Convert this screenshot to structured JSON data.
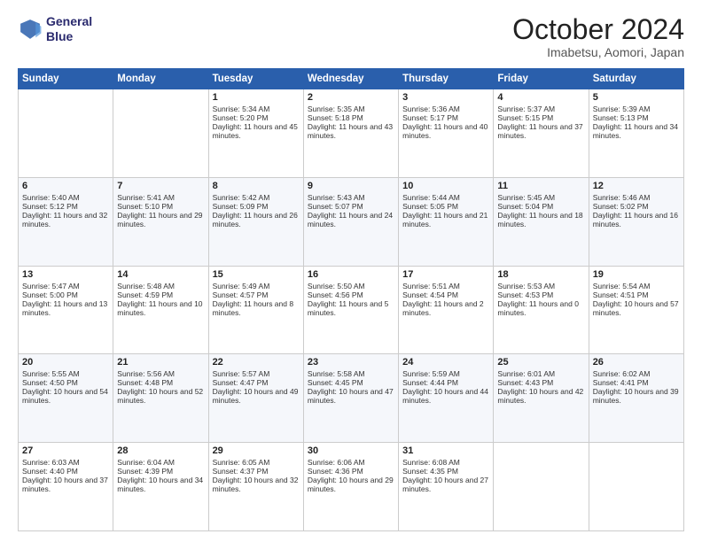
{
  "header": {
    "logo_line1": "General",
    "logo_line2": "Blue",
    "title": "October 2024",
    "location": "Imabetsu, Aomori, Japan"
  },
  "weekdays": [
    "Sunday",
    "Monday",
    "Tuesday",
    "Wednesday",
    "Thursday",
    "Friday",
    "Saturday"
  ],
  "weeks": [
    [
      {
        "day": "",
        "sunrise": "",
        "sunset": "",
        "daylight": ""
      },
      {
        "day": "",
        "sunrise": "",
        "sunset": "",
        "daylight": ""
      },
      {
        "day": "1",
        "sunrise": "Sunrise: 5:34 AM",
        "sunset": "Sunset: 5:20 PM",
        "daylight": "Daylight: 11 hours and 45 minutes."
      },
      {
        "day": "2",
        "sunrise": "Sunrise: 5:35 AM",
        "sunset": "Sunset: 5:18 PM",
        "daylight": "Daylight: 11 hours and 43 minutes."
      },
      {
        "day": "3",
        "sunrise": "Sunrise: 5:36 AM",
        "sunset": "Sunset: 5:17 PM",
        "daylight": "Daylight: 11 hours and 40 minutes."
      },
      {
        "day": "4",
        "sunrise": "Sunrise: 5:37 AM",
        "sunset": "Sunset: 5:15 PM",
        "daylight": "Daylight: 11 hours and 37 minutes."
      },
      {
        "day": "5",
        "sunrise": "Sunrise: 5:39 AM",
        "sunset": "Sunset: 5:13 PM",
        "daylight": "Daylight: 11 hours and 34 minutes."
      }
    ],
    [
      {
        "day": "6",
        "sunrise": "Sunrise: 5:40 AM",
        "sunset": "Sunset: 5:12 PM",
        "daylight": "Daylight: 11 hours and 32 minutes."
      },
      {
        "day": "7",
        "sunrise": "Sunrise: 5:41 AM",
        "sunset": "Sunset: 5:10 PM",
        "daylight": "Daylight: 11 hours and 29 minutes."
      },
      {
        "day": "8",
        "sunrise": "Sunrise: 5:42 AM",
        "sunset": "Sunset: 5:09 PM",
        "daylight": "Daylight: 11 hours and 26 minutes."
      },
      {
        "day": "9",
        "sunrise": "Sunrise: 5:43 AM",
        "sunset": "Sunset: 5:07 PM",
        "daylight": "Daylight: 11 hours and 24 minutes."
      },
      {
        "day": "10",
        "sunrise": "Sunrise: 5:44 AM",
        "sunset": "Sunset: 5:05 PM",
        "daylight": "Daylight: 11 hours and 21 minutes."
      },
      {
        "day": "11",
        "sunrise": "Sunrise: 5:45 AM",
        "sunset": "Sunset: 5:04 PM",
        "daylight": "Daylight: 11 hours and 18 minutes."
      },
      {
        "day": "12",
        "sunrise": "Sunrise: 5:46 AM",
        "sunset": "Sunset: 5:02 PM",
        "daylight": "Daylight: 11 hours and 16 minutes."
      }
    ],
    [
      {
        "day": "13",
        "sunrise": "Sunrise: 5:47 AM",
        "sunset": "Sunset: 5:00 PM",
        "daylight": "Daylight: 11 hours and 13 minutes."
      },
      {
        "day": "14",
        "sunrise": "Sunrise: 5:48 AM",
        "sunset": "Sunset: 4:59 PM",
        "daylight": "Daylight: 11 hours and 10 minutes."
      },
      {
        "day": "15",
        "sunrise": "Sunrise: 5:49 AM",
        "sunset": "Sunset: 4:57 PM",
        "daylight": "Daylight: 11 hours and 8 minutes."
      },
      {
        "day": "16",
        "sunrise": "Sunrise: 5:50 AM",
        "sunset": "Sunset: 4:56 PM",
        "daylight": "Daylight: 11 hours and 5 minutes."
      },
      {
        "day": "17",
        "sunrise": "Sunrise: 5:51 AM",
        "sunset": "Sunset: 4:54 PM",
        "daylight": "Daylight: 11 hours and 2 minutes."
      },
      {
        "day": "18",
        "sunrise": "Sunrise: 5:53 AM",
        "sunset": "Sunset: 4:53 PM",
        "daylight": "Daylight: 11 hours and 0 minutes."
      },
      {
        "day": "19",
        "sunrise": "Sunrise: 5:54 AM",
        "sunset": "Sunset: 4:51 PM",
        "daylight": "Daylight: 10 hours and 57 minutes."
      }
    ],
    [
      {
        "day": "20",
        "sunrise": "Sunrise: 5:55 AM",
        "sunset": "Sunset: 4:50 PM",
        "daylight": "Daylight: 10 hours and 54 minutes."
      },
      {
        "day": "21",
        "sunrise": "Sunrise: 5:56 AM",
        "sunset": "Sunset: 4:48 PM",
        "daylight": "Daylight: 10 hours and 52 minutes."
      },
      {
        "day": "22",
        "sunrise": "Sunrise: 5:57 AM",
        "sunset": "Sunset: 4:47 PM",
        "daylight": "Daylight: 10 hours and 49 minutes."
      },
      {
        "day": "23",
        "sunrise": "Sunrise: 5:58 AM",
        "sunset": "Sunset: 4:45 PM",
        "daylight": "Daylight: 10 hours and 47 minutes."
      },
      {
        "day": "24",
        "sunrise": "Sunrise: 5:59 AM",
        "sunset": "Sunset: 4:44 PM",
        "daylight": "Daylight: 10 hours and 44 minutes."
      },
      {
        "day": "25",
        "sunrise": "Sunrise: 6:01 AM",
        "sunset": "Sunset: 4:43 PM",
        "daylight": "Daylight: 10 hours and 42 minutes."
      },
      {
        "day": "26",
        "sunrise": "Sunrise: 6:02 AM",
        "sunset": "Sunset: 4:41 PM",
        "daylight": "Daylight: 10 hours and 39 minutes."
      }
    ],
    [
      {
        "day": "27",
        "sunrise": "Sunrise: 6:03 AM",
        "sunset": "Sunset: 4:40 PM",
        "daylight": "Daylight: 10 hours and 37 minutes."
      },
      {
        "day": "28",
        "sunrise": "Sunrise: 6:04 AM",
        "sunset": "Sunset: 4:39 PM",
        "daylight": "Daylight: 10 hours and 34 minutes."
      },
      {
        "day": "29",
        "sunrise": "Sunrise: 6:05 AM",
        "sunset": "Sunset: 4:37 PM",
        "daylight": "Daylight: 10 hours and 32 minutes."
      },
      {
        "day": "30",
        "sunrise": "Sunrise: 6:06 AM",
        "sunset": "Sunset: 4:36 PM",
        "daylight": "Daylight: 10 hours and 29 minutes."
      },
      {
        "day": "31",
        "sunrise": "Sunrise: 6:08 AM",
        "sunset": "Sunset: 4:35 PM",
        "daylight": "Daylight: 10 hours and 27 minutes."
      },
      {
        "day": "",
        "sunrise": "",
        "sunset": "",
        "daylight": ""
      },
      {
        "day": "",
        "sunrise": "",
        "sunset": "",
        "daylight": ""
      }
    ]
  ]
}
